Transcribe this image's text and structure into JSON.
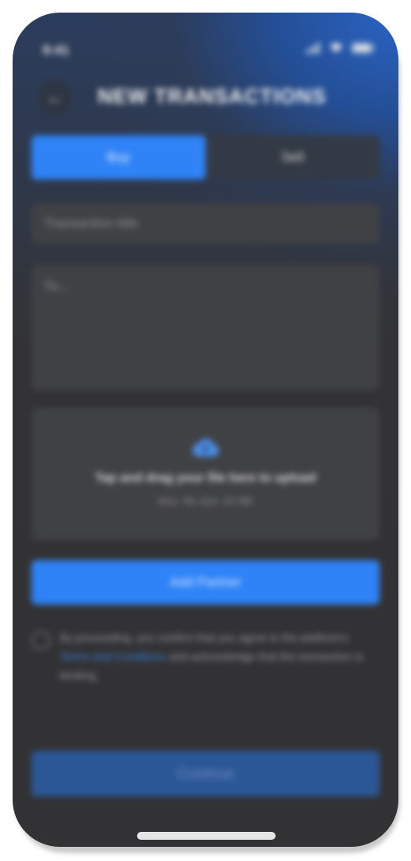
{
  "status_bar": {
    "time": "9:41"
  },
  "header": {
    "back_icon": "arrow-left-icon",
    "title": "NEW TRANSACTIONS"
  },
  "segmented": {
    "options": [
      "Buy",
      "Sell"
    ],
    "selected": "Buy"
  },
  "form": {
    "title_placeholder": "Transaction title",
    "to_placeholder": "To..."
  },
  "upload": {
    "icon": "cloud-upload-icon",
    "title": "Tap and drag your file here to upload",
    "subtitle": "Max. file size: 25 MB"
  },
  "add_partner_label": "Add Partner",
  "consent": {
    "text_before": "By proceeding, you confirm that you agree to the platform's ",
    "link_text": "Terms and Conditions",
    "text_after": " and acknowledge that the transaction is binding."
  },
  "continue_label": "Continue",
  "colors": {
    "accent": "#2f83f7",
    "background": "#333335",
    "field": "#404145",
    "continue_disabled": "#2c5797"
  }
}
